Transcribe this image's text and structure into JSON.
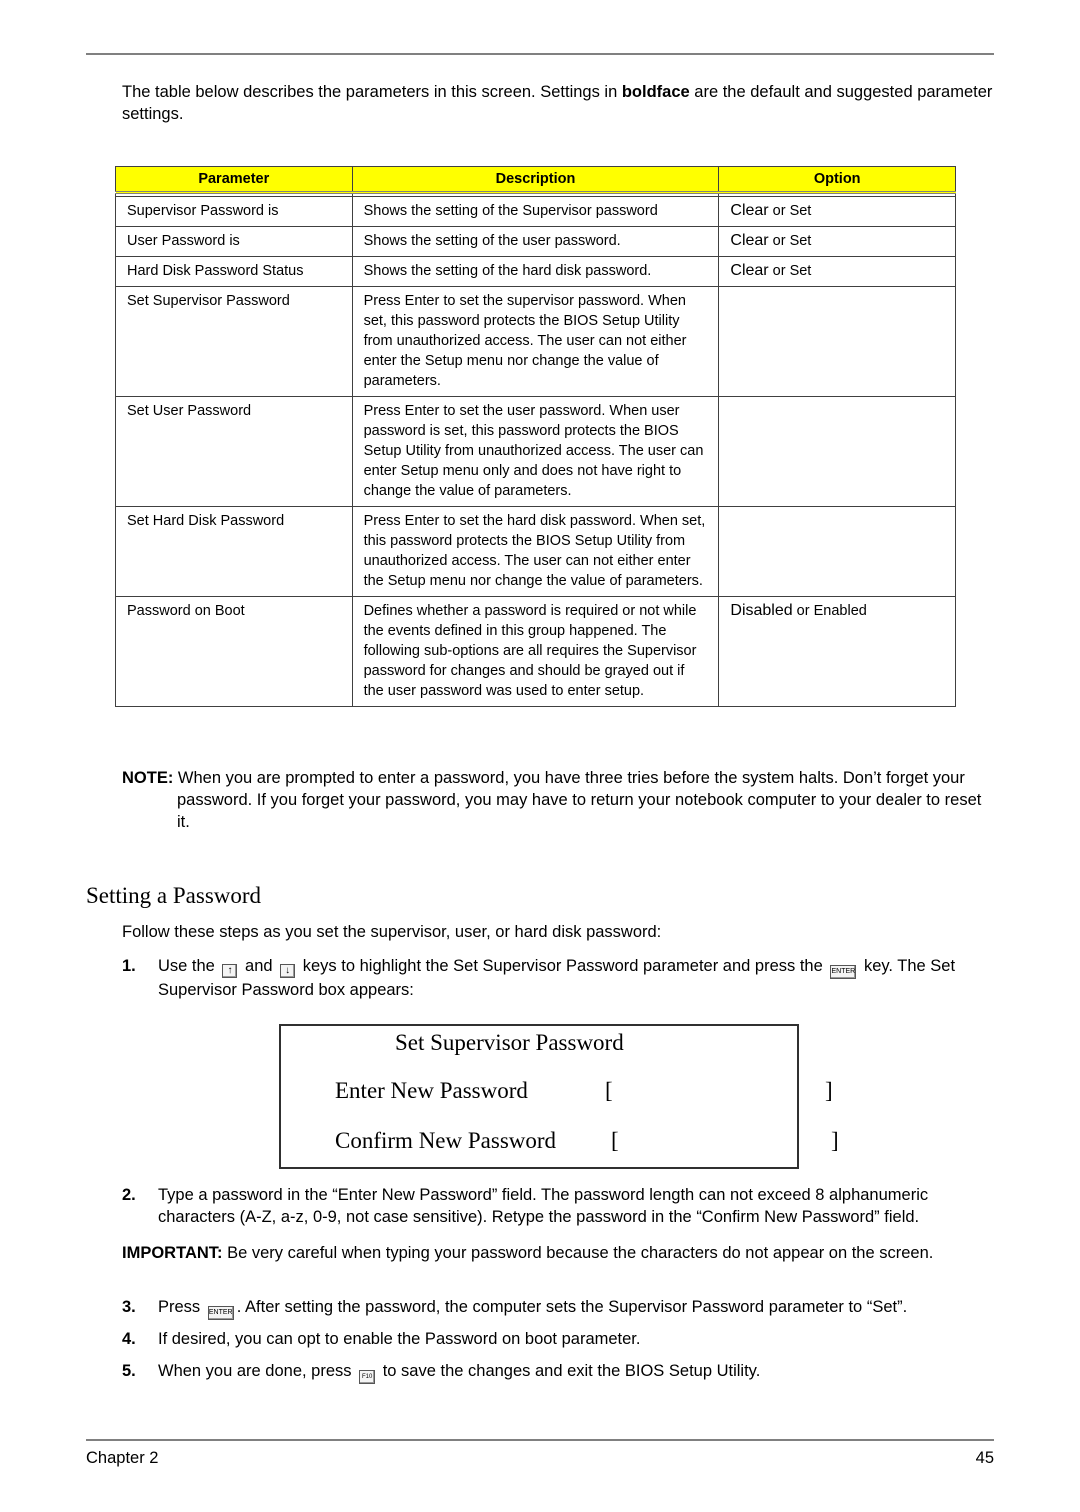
{
  "intro": {
    "before": "The table below describes the parameters in this screen. Settings in ",
    "bold": "boldface",
    "after": " are the default and suggested parameter settings."
  },
  "table": {
    "headers": [
      "Parameter",
      "Description",
      "Option"
    ],
    "header_bg": "#ffff00",
    "rows": [
      {
        "parameter": "Supervisor Password is",
        "description": "Shows the setting of the Supervisor password",
        "option_default": "Clear",
        "option_rest": " or Set"
      },
      {
        "parameter": "User Password is",
        "description": "Shows the setting of the user password.",
        "option_default": "Clear",
        "option_rest": " or Set"
      },
      {
        "parameter": "Hard Disk Password Status",
        "description": "Shows the setting of the hard disk password.",
        "option_default": "Clear",
        "option_rest": " or Set"
      },
      {
        "parameter": "Set Supervisor Password",
        "description": "Press Enter to set the supervisor password. When set, this password protects the BIOS Setup Utility from unauthorized access. The user can not either enter the Setup menu nor change the value of parameters.",
        "option_default": "",
        "option_rest": ""
      },
      {
        "parameter": "Set User Password",
        "description": "Press Enter to set the user password. When user password is set, this password protects the BIOS Setup Utility from unauthorized access. The user can enter Setup menu only and does not have right to change the value of parameters.",
        "option_default": "",
        "option_rest": ""
      },
      {
        "parameter": "Set Hard Disk Password",
        "description": "Press Enter to set the hard disk password. When set, this password protects the BIOS Setup Utility from unauthorized access. The user can not either enter the Setup menu nor change the value of parameters.",
        "option_default": "",
        "option_rest": ""
      },
      {
        "parameter": "Password on Boot",
        "description": "Defines whether a password is required or not while the events defined in this group happened. The following sub-options are all requires the Supervisor password for changes and should be grayed out if the user password was used to enter setup.",
        "option_default": "Disabled",
        "option_rest": " or Enabled"
      }
    ]
  },
  "note": {
    "label": "NOTE:",
    "text": " When you are prompted to enter a password, you have three tries before the system halts. Don’t forget your password. If you forget your password, you may have to return your notebook computer to your dealer to reset it."
  },
  "section": {
    "title": "Setting a Password",
    "follow": "Follow these steps as you set the supervisor, user, or hard disk password:"
  },
  "keys": {
    "up": "↑",
    "down": "↓",
    "enter": "ENTER",
    "f10": "F10"
  },
  "steps": {
    "s1": {
      "num": "1.",
      "a": "Use the ",
      "b": " and ",
      "c": " keys to highlight the Set Supervisor Password parameter and press the ",
      "d": " key. The Set Supervisor Password box appears:"
    },
    "s2": {
      "num": "2.",
      "text": "Type a password in the “Enter New Password” field. The password length can not exceed 8 alphanumeric characters (A-Z, a-z, 0-9, not case sensitive). Retype the password in the “Confirm New Password” field."
    },
    "s3": {
      "num": "3.",
      "a": "Press ",
      "b": ". After setting the password, the computer sets the Supervisor Password parameter to “Set”."
    },
    "s4": {
      "num": "4.",
      "text": "If desired, you can opt to enable the Password on boot parameter."
    },
    "s5": {
      "num": "5.",
      "a": "When you are done, press ",
      "b": " to save the changes and exit the BIOS Setup Utility."
    }
  },
  "password_box": {
    "title": "Set Supervisor Password",
    "enter_label": "Enter New Password",
    "confirm_label": "Confirm New Password",
    "enter_value": "",
    "confirm_value": "",
    "bracket_open": "[",
    "bracket_close": "]"
  },
  "important": {
    "label": "IMPORTANT:",
    "text": " Be very careful when typing your password because the characters do not appear on the screen."
  },
  "footer": {
    "chapter": "Chapter 2",
    "page": "45"
  }
}
